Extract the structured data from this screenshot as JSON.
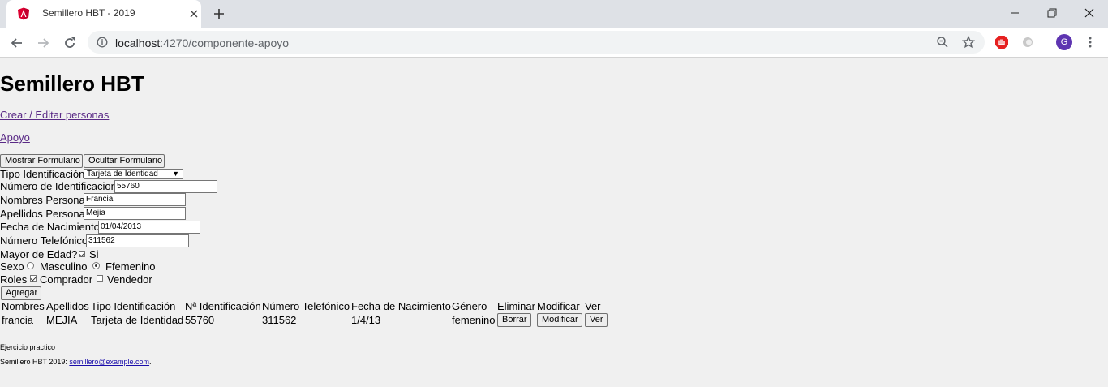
{
  "browser": {
    "tab_title": "Semillero HBT - 2019",
    "url_host": "localhost",
    "url_rest": ":4270/componente-apoyo",
    "profile_initial": "G"
  },
  "page": {
    "heading": "Semillero HBT",
    "links": {
      "crear": "Crear / Editar personas",
      "apoyo": "Apoyo"
    },
    "buttons": {
      "mostrar": "Mostrar Formulario",
      "ocultar": "Ocultar Formulario",
      "agregar": "Agregar"
    },
    "form": {
      "tipo_label": "Tipo Identificación",
      "tipo_value": "Tarjeta de Identidad",
      "numero_label": "Número de Identificacion",
      "numero_value": "55760",
      "nombres_label": "Nombres Persona",
      "nombres_value": "Francia",
      "apellidos_label": "Apellidos Persona",
      "apellidos_value": "Mejia",
      "fecha_label": "Fecha de Nacimiento",
      "fecha_value": "01/04/2013",
      "telefono_label": "Número Telefónico",
      "telefono_value": "311562",
      "mayor_label": "Mayor de Edad?",
      "mayor_option": "Si",
      "sexo_label": "Sexo",
      "sexo_masculino": "Masculino",
      "sexo_femenino": "Ffemenino",
      "roles_label": "Roles",
      "rol_comprador": "Comprador",
      "rol_vendedor": "Vendedor"
    },
    "table": {
      "headers": [
        "Nombres",
        "Apellidos",
        "Tipo Identificación",
        "Nª Identificación",
        "Número Telefónico",
        "Fecha de Nacimiento",
        "Género",
        "Eliminar",
        "Modificar",
        "Ver"
      ],
      "row": {
        "nombres": "francia",
        "apellidos": "MEJIA",
        "tipo": "Tarjeta de Identidad",
        "numero": "55760",
        "telefono": "311562",
        "fecha": "1/4/13",
        "genero": "femenino",
        "borrar": "Borrar",
        "modificar": "Modificar",
        "ver": "Ver"
      }
    },
    "footer": {
      "line1": "Ejercicio practico",
      "line2_prefix": "Semillero HBT 2019: ",
      "email": "semillero@example.com",
      "line2_suffix": "."
    }
  }
}
